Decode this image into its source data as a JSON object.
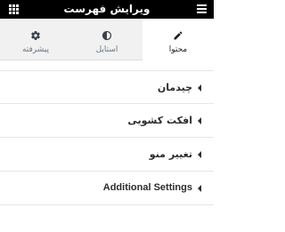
{
  "header": {
    "title": "ویرایش فهرست",
    "menu_icon": "hamburger-icon",
    "widgets_icon": "grid-icon"
  },
  "tabs": [
    {
      "label": "محتوا",
      "icon": "pencil-icon",
      "active": true
    },
    {
      "label": "استایل",
      "icon": "contrast-icon",
      "active": false
    },
    {
      "label": "پیشرفته",
      "icon": "gear-icon",
      "active": false
    }
  ],
  "sections": [
    {
      "label": "چیدمان",
      "icon": "caret-left-icon"
    },
    {
      "label": "افکت کشویی",
      "icon": "caret-left-icon"
    },
    {
      "label": "تغییر منو",
      "icon": "caret-left-icon"
    },
    {
      "label": "Additional Settings",
      "icon": "caret-left-icon"
    }
  ],
  "colors": {
    "header_bg": "#000000",
    "header_text": "#ffffff",
    "tab_inactive_bg": "#f1f1f1",
    "text": "#2c2c2c",
    "muted_text": "#6d7882"
  }
}
